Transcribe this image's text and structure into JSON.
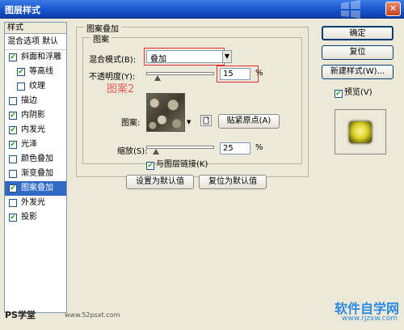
{
  "window": {
    "title": "图层样式",
    "close_glyph": "✕"
  },
  "stylelist": {
    "header": "样式",
    "blend_options": "混合选项 默认",
    "items": [
      {
        "label": "斜面和浮雕",
        "checked": true,
        "sub": false
      },
      {
        "label": "等高线",
        "checked": true,
        "sub": true
      },
      {
        "label": "纹理",
        "checked": false,
        "sub": true
      },
      {
        "label": "描边",
        "checked": false,
        "sub": false
      },
      {
        "label": "内阴影",
        "checked": true,
        "sub": false
      },
      {
        "label": "内发光",
        "checked": true,
        "sub": false
      },
      {
        "label": "光泽",
        "checked": true,
        "sub": false
      },
      {
        "label": "颜色叠加",
        "checked": false,
        "sub": false
      },
      {
        "label": "渐变叠加",
        "checked": false,
        "sub": false
      },
      {
        "label": "图案叠加",
        "checked": true,
        "sub": false,
        "selected": true
      },
      {
        "label": "外发光",
        "checked": false,
        "sub": false
      },
      {
        "label": "投影",
        "checked": true,
        "sub": false
      }
    ]
  },
  "main": {
    "group_title": "图案叠加",
    "subgroup_title": "图案",
    "blend_mode_label": "混合模式(B):",
    "blend_mode_value": "叠加",
    "opacity_label": "不透明度(Y):",
    "opacity_value": "15",
    "opacity_unit": "%",
    "annotation": "图案2",
    "pattern_label": "图案:",
    "snap_button": "贴紧原点(A)",
    "scale_label": "缩放(S):",
    "scale_value": "25",
    "scale_unit": "%",
    "link_label": "与图层链接(K)",
    "link_checked": true,
    "set_default_button": "设置为默认值",
    "reset_default_button": "复位为默认值"
  },
  "right": {
    "ok_button": "确定",
    "reset_button": "复位",
    "new_style_button": "新建样式(W)...",
    "preview_label": "预览(V)",
    "preview_checked": true
  },
  "watermarks": {
    "left": "PS学堂",
    "mid": "www.52psxt.com",
    "right": "软件自学网",
    "right_sub": "www.rjzxw.com"
  },
  "colors": {
    "accent": "#316ac5",
    "annotation": "#e35b5b",
    "check": "#21a121"
  }
}
